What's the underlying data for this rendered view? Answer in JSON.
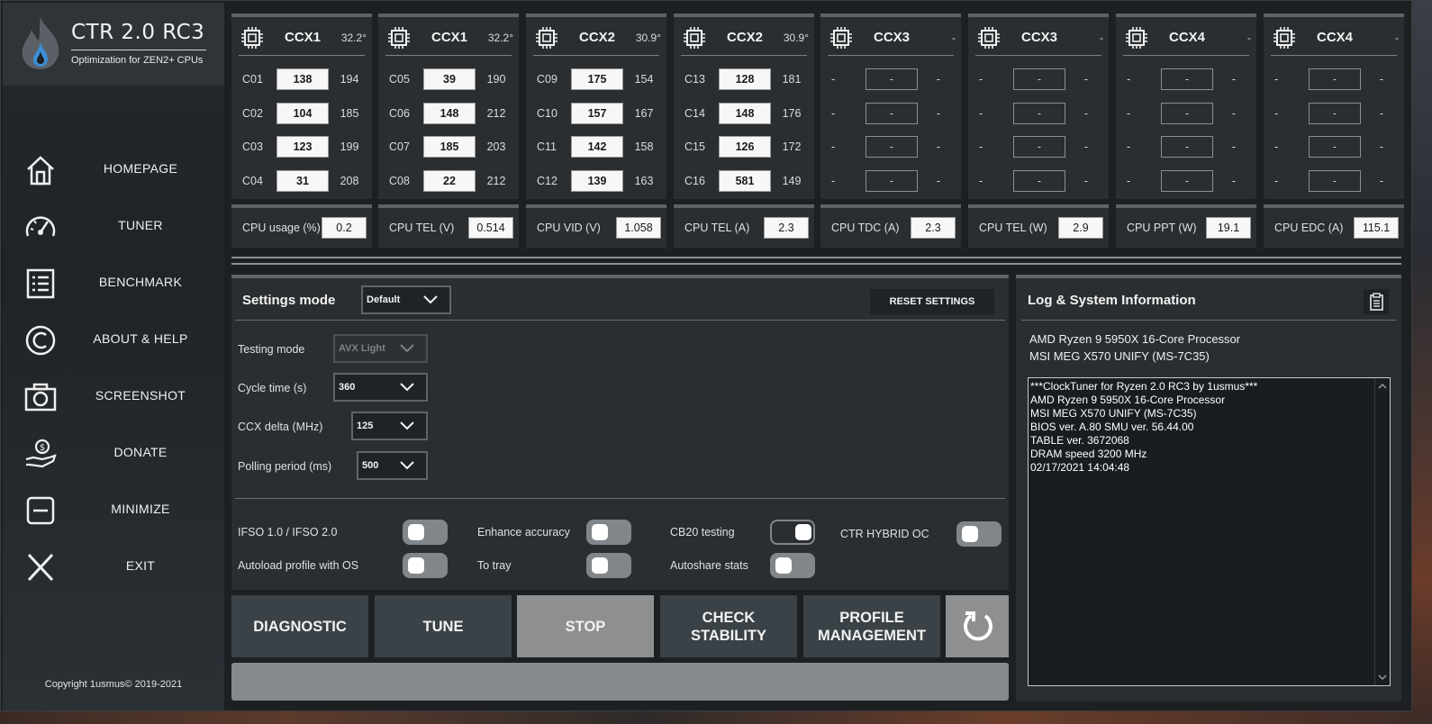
{
  "app": {
    "title": "CTR 2.0 RC3",
    "subtitle": "Optimization for ZEN2+ CPUs",
    "copyright": "Copyright 1usmus© 2019-2021"
  },
  "nav": [
    {
      "label": "HOMEPAGE",
      "icon": "home-icon"
    },
    {
      "label": "TUNER",
      "icon": "speedometer-icon"
    },
    {
      "label": "BENCHMARK",
      "icon": "list-icon"
    },
    {
      "label": "ABOUT & HELP",
      "icon": "copyright-icon"
    },
    {
      "label": "SCREENSHOT",
      "icon": "camera-icon"
    },
    {
      "label": "DONATE",
      "icon": "donate-hand-icon"
    },
    {
      "label": "MINIMIZE",
      "icon": "minimize-icon"
    },
    {
      "label": "EXIT",
      "icon": "close-x-icon"
    }
  ],
  "ccx": [
    {
      "name": "CCX1",
      "temp": "32.2°",
      "cores": [
        [
          "C01",
          "138",
          "194"
        ],
        [
          "C02",
          "104",
          "185"
        ],
        [
          "C03",
          "123",
          "199"
        ],
        [
          "C04",
          "31",
          "208"
        ]
      ]
    },
    {
      "name": "CCX1",
      "temp": "32.2°",
      "cores": [
        [
          "C05",
          "39",
          "190"
        ],
        [
          "C06",
          "148",
          "212"
        ],
        [
          "C07",
          "185",
          "203"
        ],
        [
          "C08",
          "22",
          "212"
        ]
      ]
    },
    {
      "name": "CCX2",
      "temp": "30.9°",
      "cores": [
        [
          "C09",
          "175",
          "154"
        ],
        [
          "C10",
          "157",
          "167"
        ],
        [
          "C11",
          "142",
          "158"
        ],
        [
          "C12",
          "139",
          "163"
        ]
      ]
    },
    {
      "name": "CCX2",
      "temp": "30.9°",
      "cores": [
        [
          "C13",
          "128",
          "181"
        ],
        [
          "C14",
          "148",
          "176"
        ],
        [
          "C15",
          "126",
          "172"
        ],
        [
          "C16",
          "581",
          "149"
        ]
      ]
    },
    {
      "name": "CCX3",
      "temp": "-",
      "cores": [
        [
          "-",
          "-",
          "-"
        ],
        [
          "-",
          "-",
          "-"
        ],
        [
          "-",
          "-",
          "-"
        ],
        [
          "-",
          "-",
          "-"
        ]
      ]
    },
    {
      "name": "CCX3",
      "temp": "-",
      "cores": [
        [
          "-",
          "-",
          "-"
        ],
        [
          "-",
          "-",
          "-"
        ],
        [
          "-",
          "-",
          "-"
        ],
        [
          "-",
          "-",
          "-"
        ]
      ]
    },
    {
      "name": "CCX4",
      "temp": "-",
      "cores": [
        [
          "-",
          "-",
          "-"
        ],
        [
          "-",
          "-",
          "-"
        ],
        [
          "-",
          "-",
          "-"
        ],
        [
          "-",
          "-",
          "-"
        ]
      ]
    },
    {
      "name": "CCX4",
      "temp": "-",
      "cores": [
        [
          "-",
          "-",
          "-"
        ],
        [
          "-",
          "-",
          "-"
        ],
        [
          "-",
          "-",
          "-"
        ],
        [
          "-",
          "-",
          "-"
        ]
      ]
    }
  ],
  "metrics": [
    {
      "label": "CPU usage (%)",
      "value": "0.2"
    },
    {
      "label": "CPU TEL (V)",
      "value": "0.514"
    },
    {
      "label": "CPU VID (V)",
      "value": "1.058"
    },
    {
      "label": "CPU TEL (A)",
      "value": "2.3"
    },
    {
      "label": "CPU TDC (A)",
      "value": "2.3"
    },
    {
      "label": "CPU TEL (W)",
      "value": "2.9"
    },
    {
      "label": "CPU PPT (W)",
      "value": "19.1"
    },
    {
      "label": "CPU EDC (A)",
      "value": "115.1"
    }
  ],
  "settings": {
    "title": "Settings mode",
    "mode_value": "Default",
    "reset_label": "RESET SETTINGS",
    "testing_mode_label": "Testing mode",
    "testing_mode_value": "AVX Light",
    "cycle_time_label": "Cycle time (s)",
    "cycle_time_value": "360",
    "ccx_delta_label": "CCX delta (MHz)",
    "ccx_delta_value": "125",
    "polling_label": "Polling period (ms)",
    "polling_value": "500",
    "toggles": [
      {
        "label": "IFSO 1.0 / IFSO 2.0",
        "on": false
      },
      {
        "label": "Enhance accuracy",
        "on": false
      },
      {
        "label": "CB20 testing",
        "on": true
      },
      {
        "label": "CTR HYBRID OC",
        "on": false
      },
      {
        "label": "Autoload profile with OS",
        "on": false
      },
      {
        "label": "To tray",
        "on": false
      },
      {
        "label": "Autoshare stats",
        "on": false
      }
    ]
  },
  "actions": {
    "diagnostic": "DIAGNOSTIC",
    "tune": "TUNE",
    "stop": "STOP",
    "check_stability_1": "CHECK",
    "check_stability_2": "STABILITY",
    "profile_1": "PROFILE",
    "profile_2": "MANAGEMENT"
  },
  "log": {
    "title": "Log & System Information",
    "cpu": "AMD Ryzen 9 5950X 16-Core Processor",
    "board": "MSI MEG X570 UNIFY (MS-7C35)",
    "lines": [
      "***ClockTuner for Ryzen 2.0 RC3 by 1usmus***",
      "AMD Ryzen 9 5950X 16-Core Processor",
      "MSI MEG X570 UNIFY (MS-7C35)",
      "BIOS ver. A.80 SMU ver. 56.44.00",
      "TABLE ver. 3672068",
      "DRAM speed 3200 MHz",
      "02/17/2021 14:04:48"
    ]
  },
  "colors": {
    "panel": "#2a2e31",
    "background": "#1d2023",
    "button": "#3a4247",
    "stop_button": "#8e8f90"
  }
}
